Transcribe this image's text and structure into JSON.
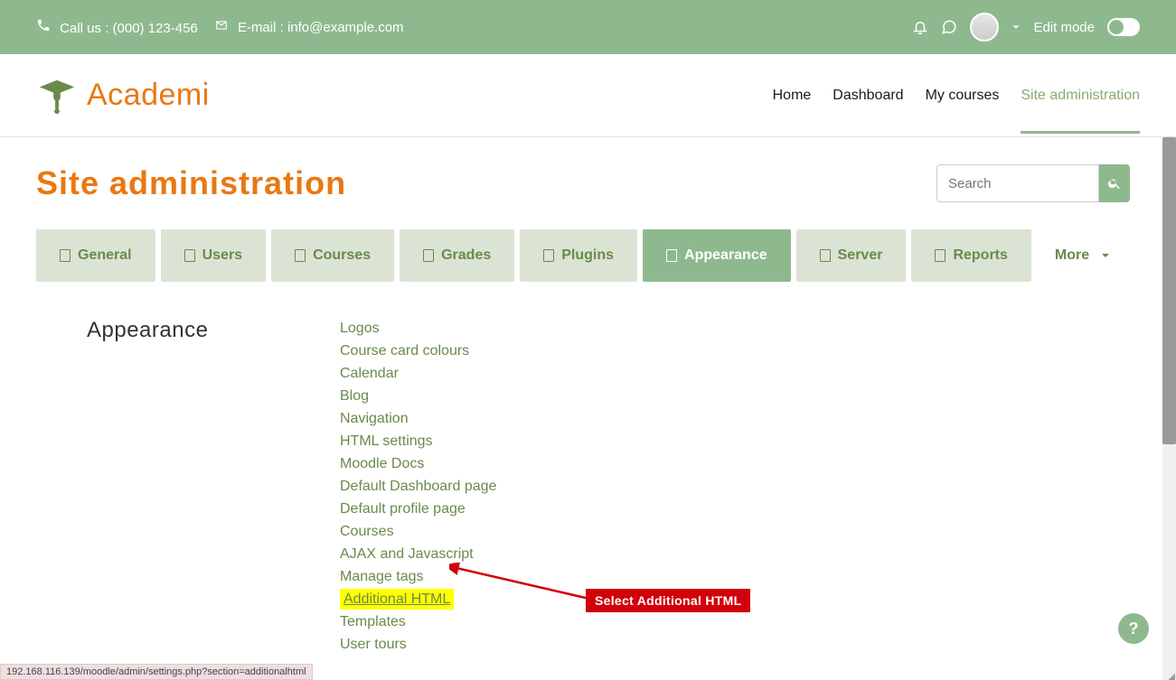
{
  "topbar": {
    "call_label": "Call us : (000) 123-456",
    "email_label": "E-mail : info@example.com",
    "edit_mode_label": "Edit mode"
  },
  "logo": {
    "text": "Academi"
  },
  "nav": {
    "items": [
      {
        "label": "Home"
      },
      {
        "label": "Dashboard"
      },
      {
        "label": "My courses"
      },
      {
        "label": "Site administration",
        "active": true
      }
    ]
  },
  "page": {
    "title": "Site administration"
  },
  "search": {
    "placeholder": "Search"
  },
  "tabs": [
    {
      "label": "General"
    },
    {
      "label": "Users"
    },
    {
      "label": "Courses"
    },
    {
      "label": "Grades"
    },
    {
      "label": "Plugins"
    },
    {
      "label": "Appearance",
      "active": true
    },
    {
      "label": "Server"
    },
    {
      "label": "Reports"
    }
  ],
  "tabs_more": "More",
  "section": {
    "title": "Appearance",
    "links": [
      "Logos",
      "Course card colours",
      "Calendar",
      "Blog",
      "Navigation",
      "HTML settings",
      "Moodle Docs",
      "Default Dashboard page",
      "Default profile page",
      "Courses",
      "AJAX and Javascript",
      "Manage tags",
      "Additional HTML",
      "Templates",
      "User tours"
    ],
    "highlight_index": 12
  },
  "annotation": {
    "label": "Select Additional HTML"
  },
  "help": {
    "label": "?"
  },
  "statusbar": {
    "text": "192.168.116.139/moodle/admin/settings.php?section=additionalhtml"
  }
}
